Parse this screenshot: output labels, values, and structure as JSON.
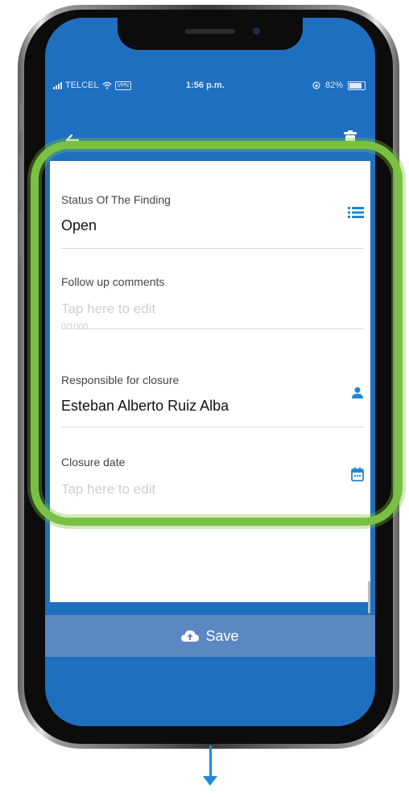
{
  "status_bar": {
    "carrier": "TELCEL",
    "vpn": "VPN",
    "time": "1:56 p.m.",
    "battery": "82%"
  },
  "app_bar": {
    "back_icon": "arrow-left-icon",
    "delete_icon": "trash-icon"
  },
  "form": {
    "status": {
      "label": "Status Of The Finding",
      "value": "Open",
      "icon": "list-icon"
    },
    "comments": {
      "label": "Follow up comments",
      "placeholder": "Tap here to edit",
      "counter": "0/1000"
    },
    "responsible": {
      "label": "Responsible for closure",
      "value": "Esteban Alberto Ruiz Alba",
      "icon": "person-icon"
    },
    "closure_date": {
      "label": "Closure date",
      "placeholder": "Tap here to edit",
      "icon": "calendar-icon"
    }
  },
  "save_button": {
    "label": "Save",
    "icon": "cloud-upload-icon"
  },
  "colors": {
    "primary": "#1f6fc0",
    "save_bar": "#5b88c2",
    "highlight": "#7ac143",
    "accent_icon": "#1e88d6",
    "arrow": "#1f8ad3"
  }
}
